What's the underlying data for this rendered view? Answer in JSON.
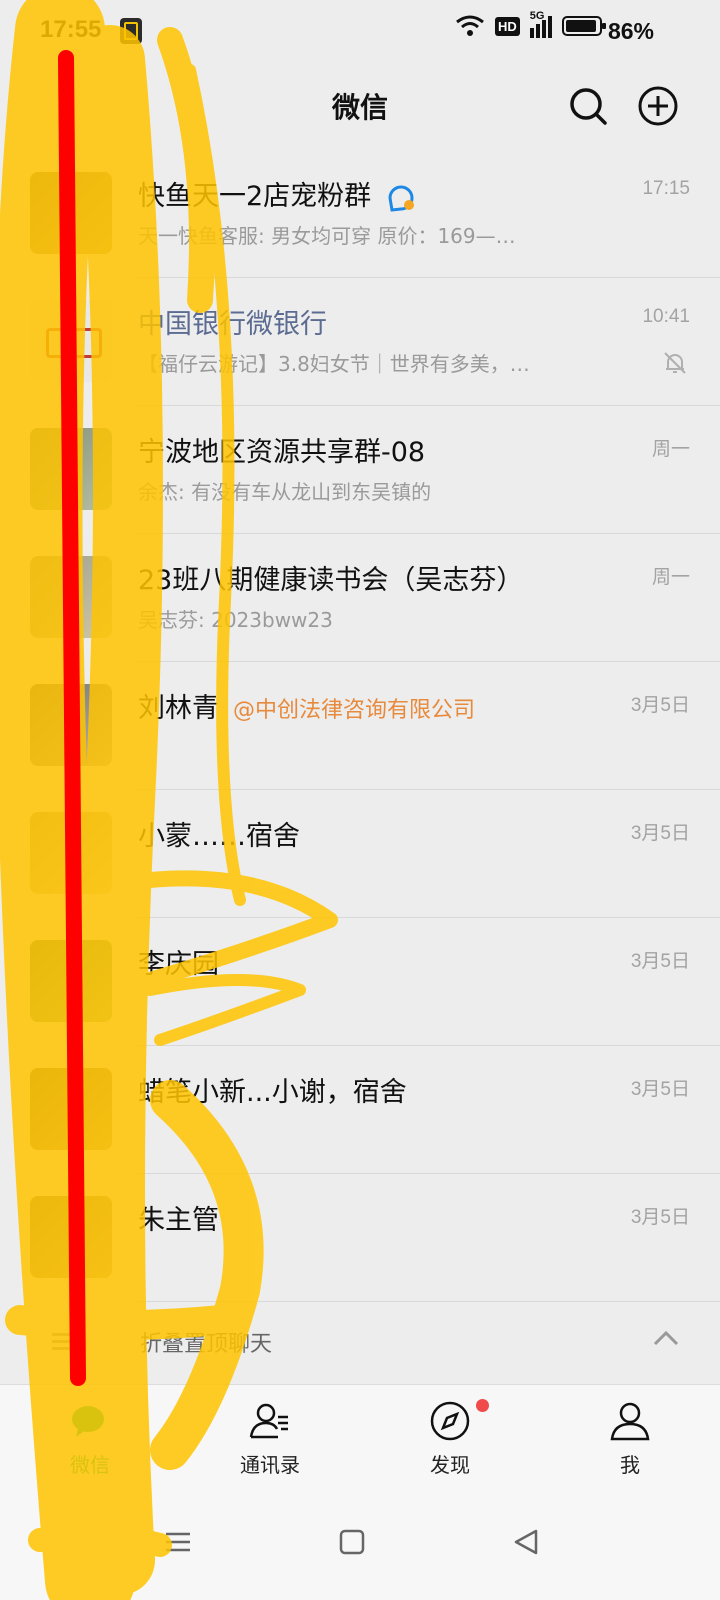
{
  "status_bar": {
    "time": "17:55",
    "network": "5G",
    "hd": "HD",
    "battery": "86%"
  },
  "header": {
    "title": "微信",
    "icons": [
      "search-icon",
      "add-icon"
    ]
  },
  "chats": [
    {
      "name": "快鱼天一2店宠粉群",
      "preview": "天一快鱼客服: 男女均可穿 原价：169—…",
      "time": "17:15",
      "badge": "group-badge-icon"
    },
    {
      "name": "中国银行微银行",
      "preview": "【福仔云游记】3.8妇女节｜世界有多美，…",
      "time": "10:41",
      "muted": true,
      "official": true
    },
    {
      "name": "宁波地区资源共享群-08",
      "preview": "余杰: 有没有车从龙山到东吴镇的",
      "time": "周一"
    },
    {
      "name": "23班八期健康读书会（吴志芬）",
      "preview": "吴志芬: 2023bww23",
      "time": "周一"
    },
    {
      "name": "刘林青",
      "mention": "@中创法律咨询有限公司",
      "time": "3月5日"
    },
    {
      "name": "小蒙……宿舍",
      "time": "3月5日"
    },
    {
      "name": "李庆园",
      "time": "3月5日"
    },
    {
      "name": "蜡笔小新...小谢，宿舍",
      "time": "3月5日"
    },
    {
      "name": "朱主管",
      "time": "3月5日"
    }
  ],
  "fold": {
    "label": "折叠置顶聊天"
  },
  "tabs": [
    {
      "label": "微信",
      "icon": "chat-icon",
      "active": true
    },
    {
      "label": "通讯录",
      "icon": "contacts-icon"
    },
    {
      "label": "发现",
      "icon": "compass-icon",
      "dot": true
    },
    {
      "label": "我",
      "icon": "person-icon"
    }
  ],
  "colors": {
    "background": "#ededed",
    "accent_green": "#07c160",
    "official_name": "#5b6b91",
    "mention": "#e88a3c",
    "scribble_yellow": "#ffc400",
    "scribble_red": "#ff0000"
  }
}
